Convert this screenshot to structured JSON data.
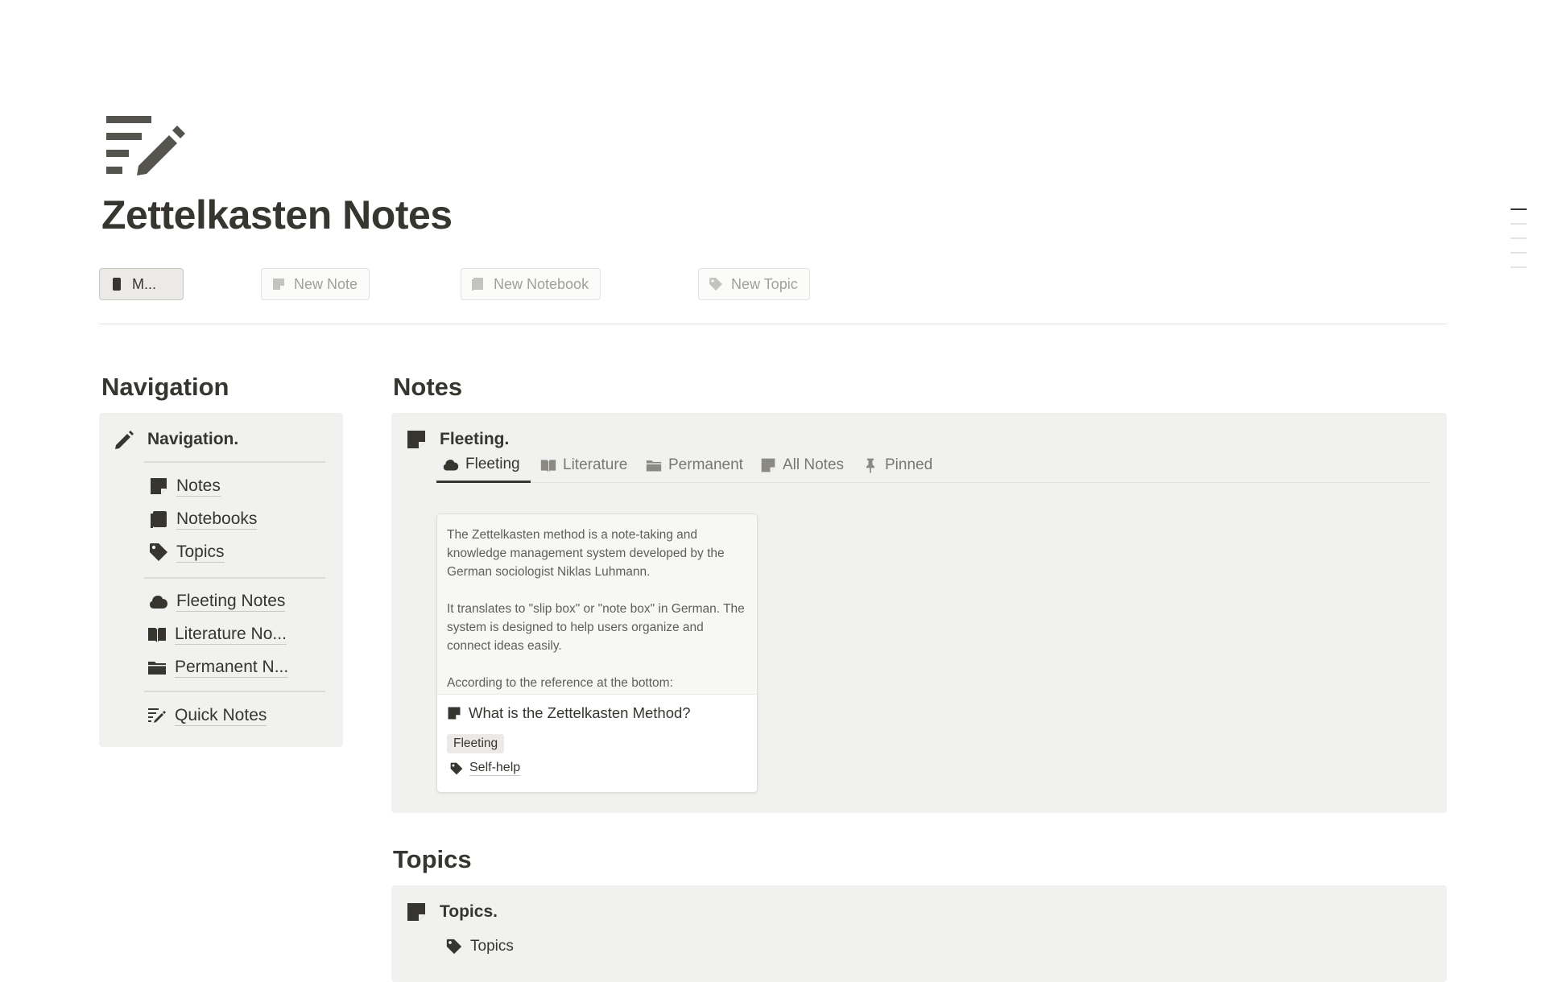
{
  "page": {
    "title": "Zettelkasten Notes",
    "icon": "quick-notes-icon"
  },
  "actions": {
    "primary_label": "M...",
    "new_note": "New Note",
    "new_notebook": "New Notebook",
    "new_topic": "New Topic"
  },
  "navigation": {
    "heading": "Navigation",
    "panel_title": "Navigation.",
    "groups": [
      [
        {
          "label": "Notes",
          "icon": "note-icon"
        },
        {
          "label": "Notebooks",
          "icon": "notebook-icon"
        },
        {
          "label": "Topics",
          "icon": "tag-icon"
        }
      ],
      [
        {
          "label": "Fleeting Notes",
          "icon": "cloud-icon"
        },
        {
          "label": "Literature No...",
          "icon": "book-open-icon"
        },
        {
          "label": "Permanent N...",
          "icon": "folder-icon"
        }
      ],
      [
        {
          "label": "Quick Notes",
          "icon": "quick-notes-icon"
        }
      ]
    ]
  },
  "notes": {
    "heading": "Notes",
    "panel_title": "Fleeting.",
    "tabs": [
      {
        "label": "Fleeting",
        "icon": "cloud-icon",
        "active": true
      },
      {
        "label": "Literature",
        "icon": "book-open-icon",
        "active": false
      },
      {
        "label": "Permanent",
        "icon": "folder-icon",
        "active": false
      },
      {
        "label": "All Notes",
        "icon": "note-icon",
        "active": false
      },
      {
        "label": "Pinned",
        "icon": "pin-icon",
        "active": false
      }
    ],
    "card": {
      "preview": [
        "The Zettelkasten method is a note-taking and knowledge management system developed by the German sociologist Niklas Luhmann.",
        "It translates to \"slip box\" or \"note box\" in German. The system is designed to help users organize and connect ideas easily.",
        "According to the reference at the bottom:"
      ],
      "title": "What is the Zettelkasten Method?",
      "tag": "Fleeting",
      "topic": "Self-help"
    }
  },
  "topics": {
    "heading": "Topics",
    "panel_title": "Topics.",
    "view_label": "Topics"
  },
  "colors": {
    "text": "#37352f",
    "muted": "#a19f9a",
    "panel_bg": "#f1f1ef"
  }
}
